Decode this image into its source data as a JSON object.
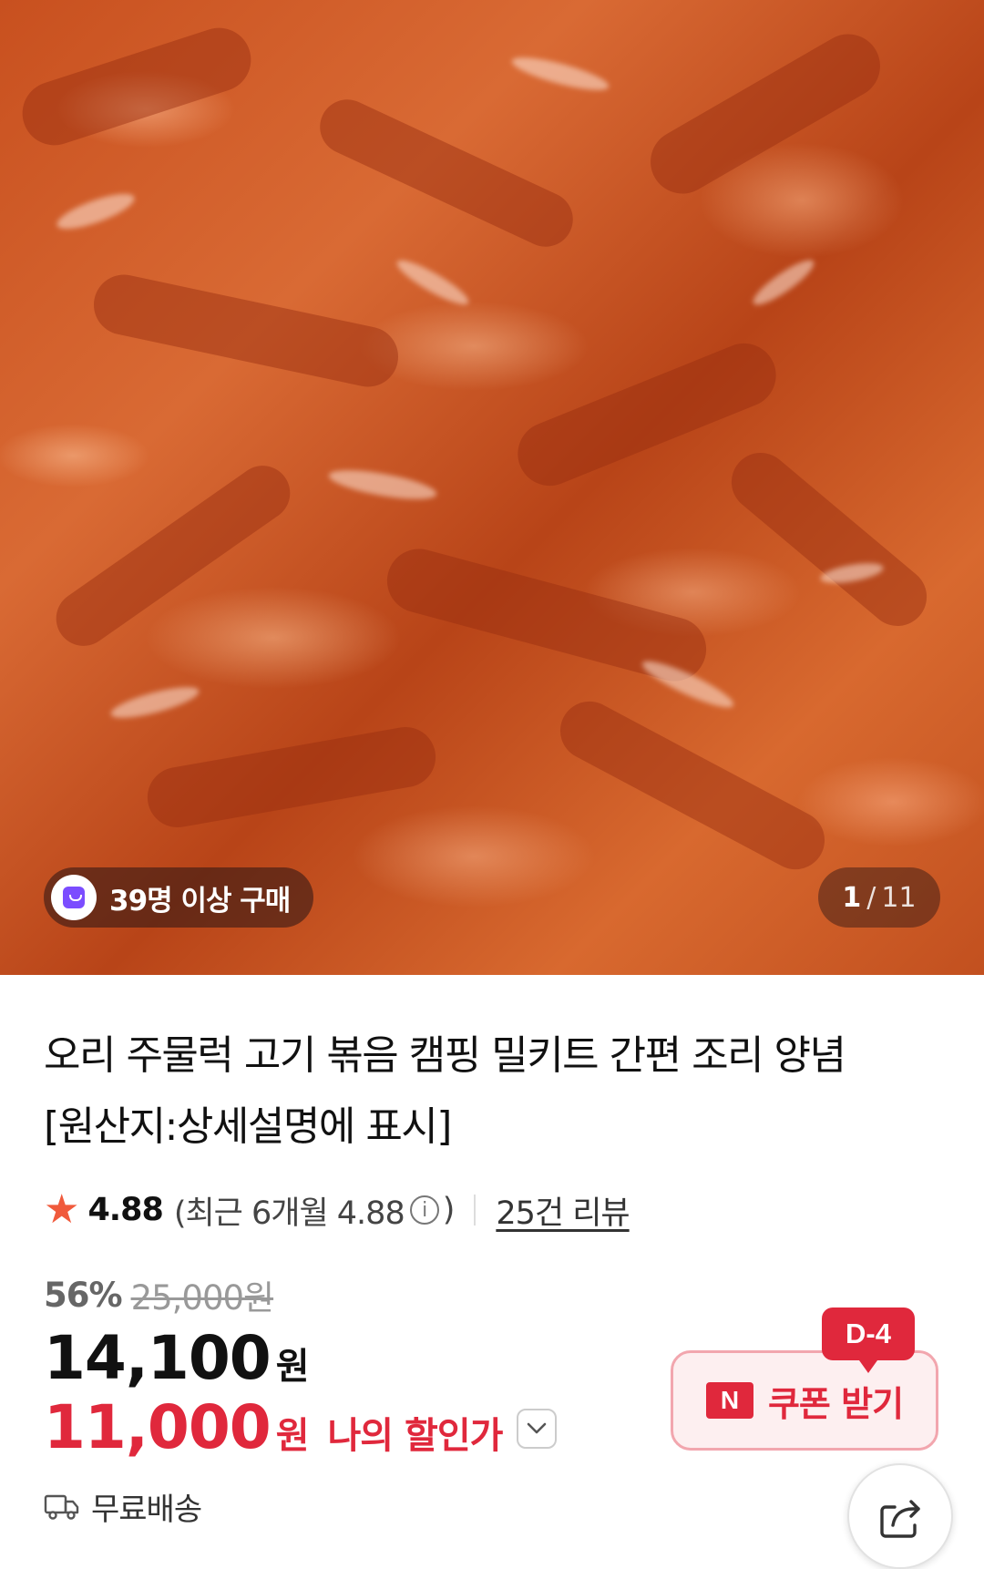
{
  "gallery": {
    "purchase_badge": "39명 이상 구매",
    "current_index": "1",
    "separator": "/",
    "total": "11"
  },
  "product": {
    "title_line1": "오리 주물럭 고기 볶음 캠핑 밀키트 간편 조리 양념",
    "title_line2": "[원산지:상세설명에 표시]"
  },
  "rating": {
    "score": "4.88",
    "recent_prefix": "(최근 6개월 4.88",
    "info_glyph": "i",
    "recent_suffix": ")",
    "review_link": "25건 리뷰"
  },
  "price": {
    "discount_percent": "56%",
    "original_price": "25,000원",
    "sale_price": "14,100",
    "unit": "원",
    "my_price": "11,000",
    "my_price_unit": "원",
    "my_price_label": "나의 할인가"
  },
  "shipping": {
    "label": "무료배송"
  },
  "coupon": {
    "dday": "D-4",
    "n_logo": "N",
    "label": "쿠폰 받기"
  },
  "colors": {
    "accent_red": "#e0283c",
    "star": "#f05a3c",
    "purple_badge": "#7b4dff"
  },
  "icons": [
    "shopping-bag-icon",
    "star-icon",
    "info-icon",
    "chevron-down-icon",
    "truck-icon",
    "n-pay-logo-icon",
    "share-icon"
  ]
}
